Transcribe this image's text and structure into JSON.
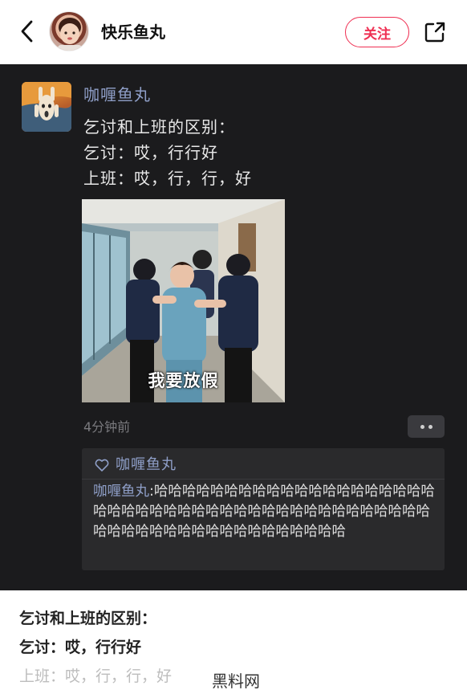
{
  "header": {
    "username": "快乐鱼丸",
    "follow_label": "关注",
    "icons": {
      "back": "chevron-left-icon",
      "share": "share-external-icon",
      "avatar": "user-avatar"
    },
    "accent_color": "#ef2f52"
  },
  "post": {
    "author": "咖喱鱼丸",
    "lines": [
      "乞讨和上班的区别：",
      "乞讨：哎，行行好",
      "上班：哎，行，行，好"
    ],
    "image_caption": "我要放假",
    "time": "4分钟前",
    "like": {
      "icon": "heart-outline-icon",
      "name": "咖喱鱼丸"
    },
    "comment": {
      "author": "咖喱鱼丸",
      "separator": ":",
      "text": "哈哈哈哈哈哈哈哈哈哈哈哈哈哈哈哈哈哈哈哈哈哈哈哈哈哈哈哈哈哈哈哈哈哈哈哈哈哈哈哈哈哈哈哈哈哈哈哈哈哈哈哈哈哈哈哈哈哈哈哈哈哈"
    },
    "theme": {
      "background": "#1b1b1d",
      "name_color": "#8f9fc8"
    }
  },
  "caption_text": {
    "line1": "乞讨和上班的区别：",
    "line2": "乞讨：哎，行行好",
    "line3": "上班：哎，行，行，好"
  },
  "watermark": "黑料网"
}
